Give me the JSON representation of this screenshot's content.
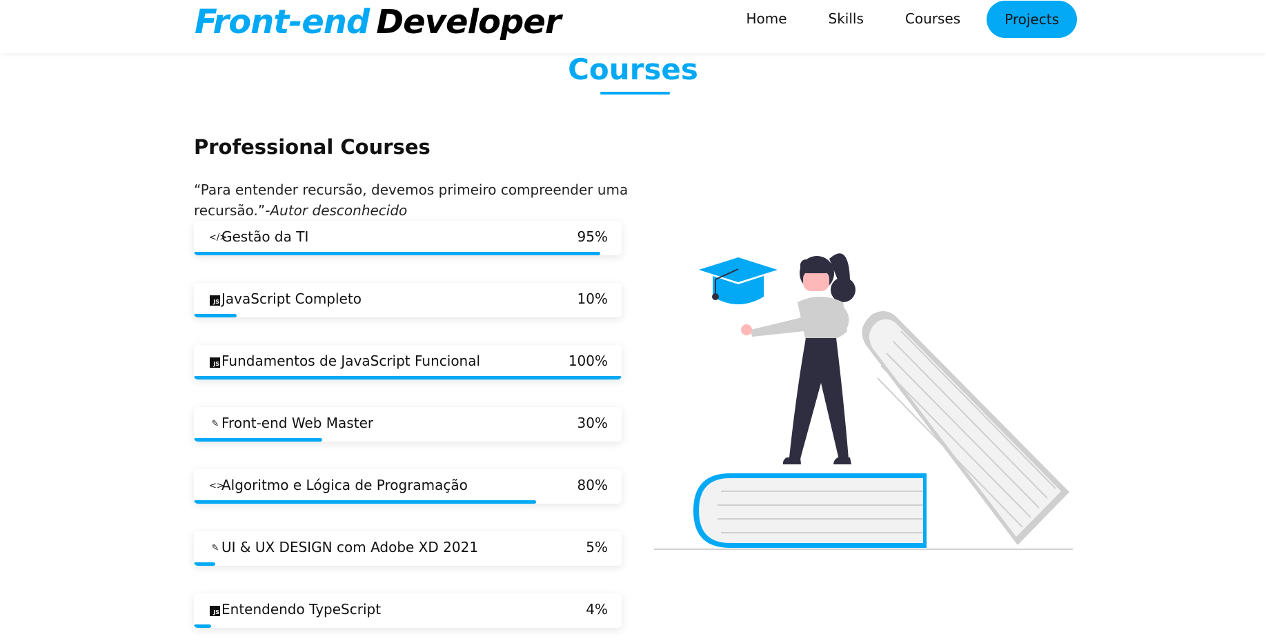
{
  "header": {
    "logo_accent": "Front-end",
    "logo_plain": "Developer",
    "nav": [
      {
        "label": "Home"
      },
      {
        "label": "Skills"
      },
      {
        "label": "Courses"
      },
      {
        "label": "Projects"
      }
    ]
  },
  "section": {
    "title": "Courses",
    "subtitle": "Professional Courses",
    "quote": "“Para entender recursão, devemos primeiro compreender uma recursão.”",
    "quote_author": "-Autor desconhecido"
  },
  "courses": [
    {
      "icon": "code-slash-icon",
      "name": "Gestão da TI",
      "percent_label": "95%",
      "percent": 95
    },
    {
      "icon": "javascript-icon",
      "name": "JavaScript Completo",
      "percent_label": "10%",
      "percent": 10
    },
    {
      "icon": "javascript-icon",
      "name": "Fundamentos de JavaScript Funcional",
      "percent_label": "100%",
      "percent": 100
    },
    {
      "icon": "pen-icon",
      "name": "Front-end Web Master",
      "percent_label": "30%",
      "percent": 30
    },
    {
      "icon": "code-brackets-icon",
      "name": "Algoritmo e Lógica de Programação",
      "percent_label": "80%",
      "percent": 80
    },
    {
      "icon": "pen-icon",
      "name": "UI & UX DESIGN com Adobe XD 2021",
      "percent_label": "5%",
      "percent": 5
    },
    {
      "icon": "javascript-icon",
      "name": "Entendendo TypeScript",
      "percent_label": "4%",
      "percent": 4
    }
  ],
  "colors": {
    "accent": "#03a9f4",
    "text": "#111111",
    "book_gray": "#f0f0f0",
    "figure_dark": "#2f2e41",
    "shirt": "#cfcfcf",
    "skin": "#ffb8b8"
  }
}
